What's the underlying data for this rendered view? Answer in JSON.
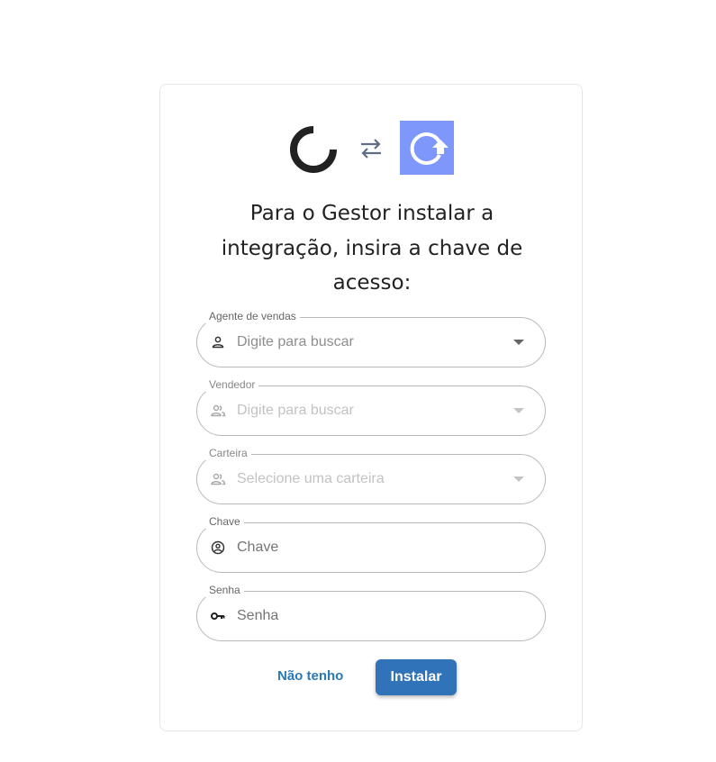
{
  "title": "Para o Gestor instalar a integração, insira a chave de acesso:",
  "logos": {
    "left_icon": "ring-logo-icon",
    "middle_icon": "swap-arrows-icon",
    "right_icon": "upload-refresh-logo-icon",
    "right_bg_color": "#7e97fb"
  },
  "fields": {
    "agent": {
      "label": "Agente de vendas",
      "placeholder": "Digite para buscar",
      "icon": "person-icon"
    },
    "seller": {
      "label": "Vendedor",
      "placeholder": "Digite para buscar",
      "icon": "people-icon"
    },
    "wallet": {
      "label": "Carteira",
      "placeholder": "Selecione uma carteira",
      "icon": "people-icon"
    },
    "key": {
      "label": "Chave",
      "placeholder": "Chave",
      "icon": "account-circle-icon"
    },
    "password": {
      "label": "Senha",
      "placeholder": "Senha",
      "icon": "key-icon"
    }
  },
  "actions": {
    "secondary_label": "Não tenho",
    "primary_label": "Instalar",
    "primary_color": "#3173b8",
    "link_color": "#2a78b4"
  }
}
